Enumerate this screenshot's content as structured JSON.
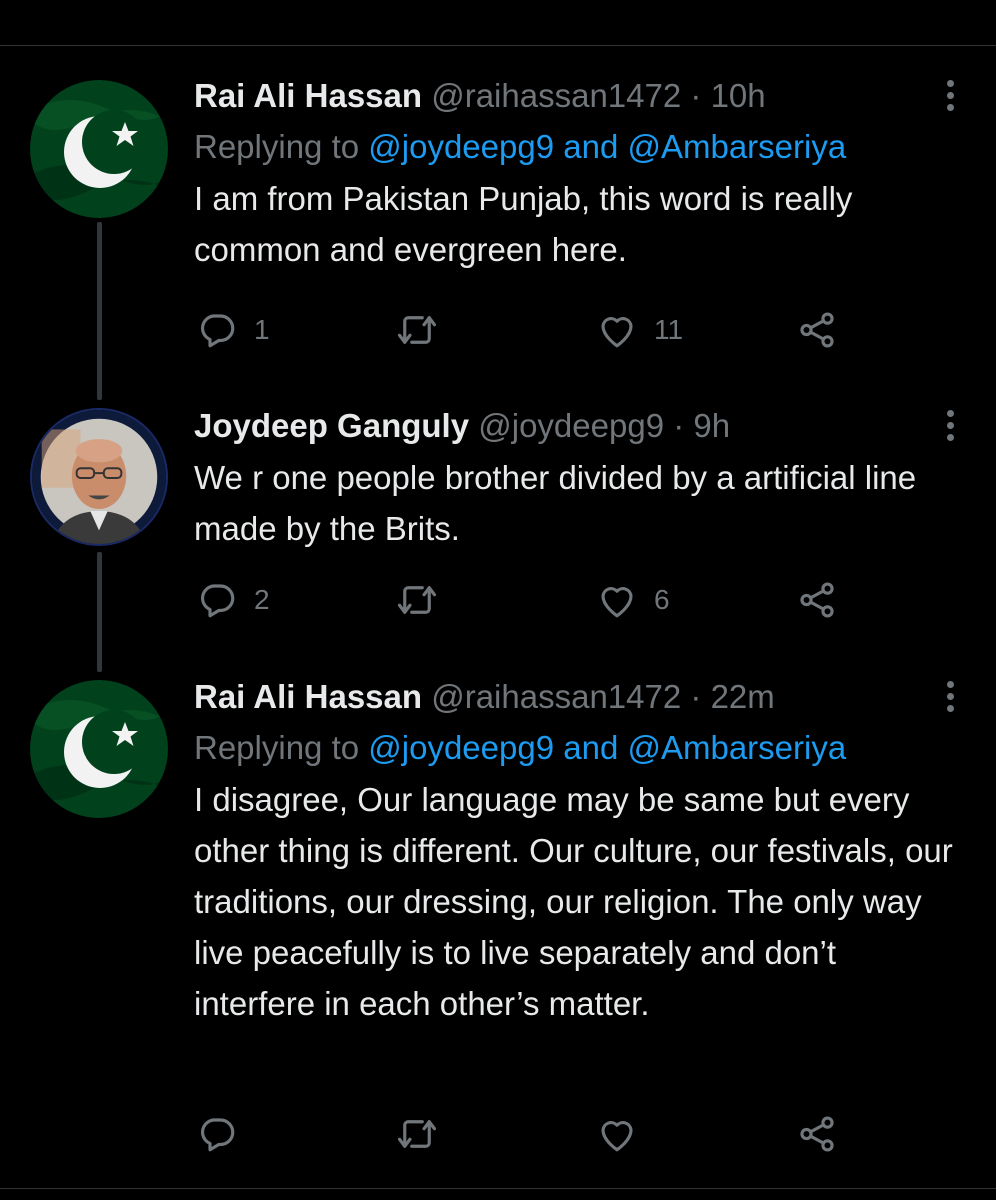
{
  "tweets": [
    {
      "name": "Rai Ali Hassan",
      "handle": "@raihassan1472",
      "dot": "·",
      "time": "10h",
      "replying_prefix": "Replying to ",
      "replying_mentions": "@joydeepg9 and @Ambarseriya",
      "text": "I am from Pakistan Punjab, this word is really common and evergreen here.",
      "avatar": "pakistan-flag",
      "reply_count": "1",
      "retweet_count": "",
      "like_count": "11"
    },
    {
      "name": "Joydeep Ganguly",
      "handle": "@joydeepg9",
      "dot": "·",
      "time": "9h",
      "text": "We r one people brother divided by a artificial line made by the Brits.",
      "avatar": "profile-photo",
      "reply_count": "2",
      "retweet_count": "",
      "like_count": "6"
    },
    {
      "name": "Rai Ali Hassan",
      "handle": "@raihassan1472",
      "dot": "·",
      "time": "22m",
      "replying_prefix": "Replying to ",
      "replying_mentions": "@joydeepg9 and @Ambarseriya",
      "text": "I disagree, Our language may be same but every other thing is different. Our culture, our festivals, our traditions, our dressing, our religion. The only way live peacefully is to live separately and don’t interfere in each other’s matter.",
      "avatar": "pakistan-flag",
      "reply_count": "",
      "retweet_count": "",
      "like_count": ""
    }
  ],
  "icons": [
    "reply-icon",
    "retweet-icon",
    "like-icon",
    "share-icon",
    "more-icon"
  ],
  "colors": {
    "background": "#000000",
    "text": "#e7e9ea",
    "secondary": "#71767b",
    "link": "#1d9bf0",
    "divider": "#2f3336",
    "flag_green": "#01411c"
  }
}
